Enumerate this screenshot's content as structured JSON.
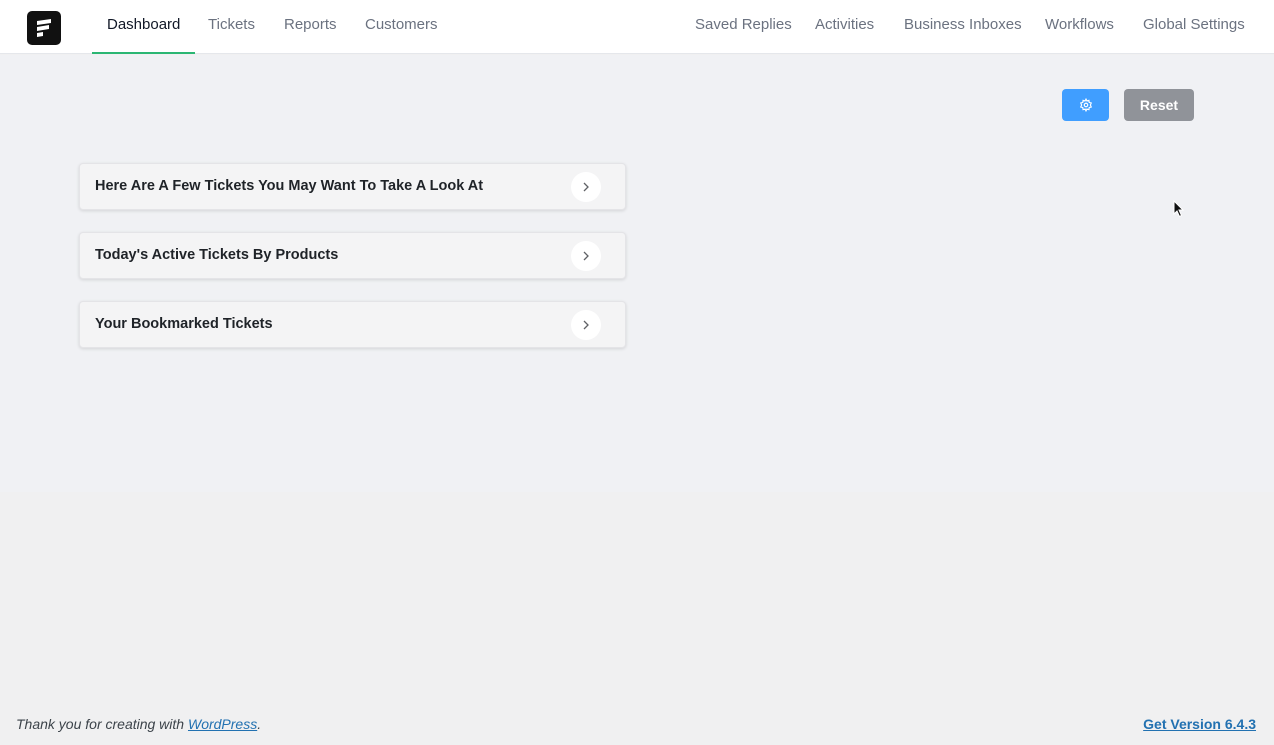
{
  "nav": {
    "left": [
      {
        "label": "Dashboard",
        "active": true
      },
      {
        "label": "Tickets"
      },
      {
        "label": "Reports"
      },
      {
        "label": "Customers"
      }
    ],
    "right": [
      {
        "label": "Saved Replies"
      },
      {
        "label": "Activities"
      },
      {
        "label": "Business Inboxes"
      },
      {
        "label": "Workflows"
      },
      {
        "label": "Global Settings"
      }
    ]
  },
  "toolbar": {
    "settings_icon": "gear-icon",
    "reset_label": "Reset"
  },
  "cards": [
    {
      "title": "Here Are A Few Tickets You May Want To Take A Look At"
    },
    {
      "title": "Today's Active Tickets By Products"
    },
    {
      "title": "Your Bookmarked Tickets"
    }
  ],
  "footer": {
    "thanks_prefix": "Thank you for creating with ",
    "wordpress_link": "WordPress",
    "thanks_suffix": ".",
    "version_link": "Get Version 6.4.3"
  },
  "colors": {
    "accent_tab": "#2bb673",
    "primary_button": "#409eff",
    "reset_button": "#909399",
    "link": "#2271b1"
  }
}
